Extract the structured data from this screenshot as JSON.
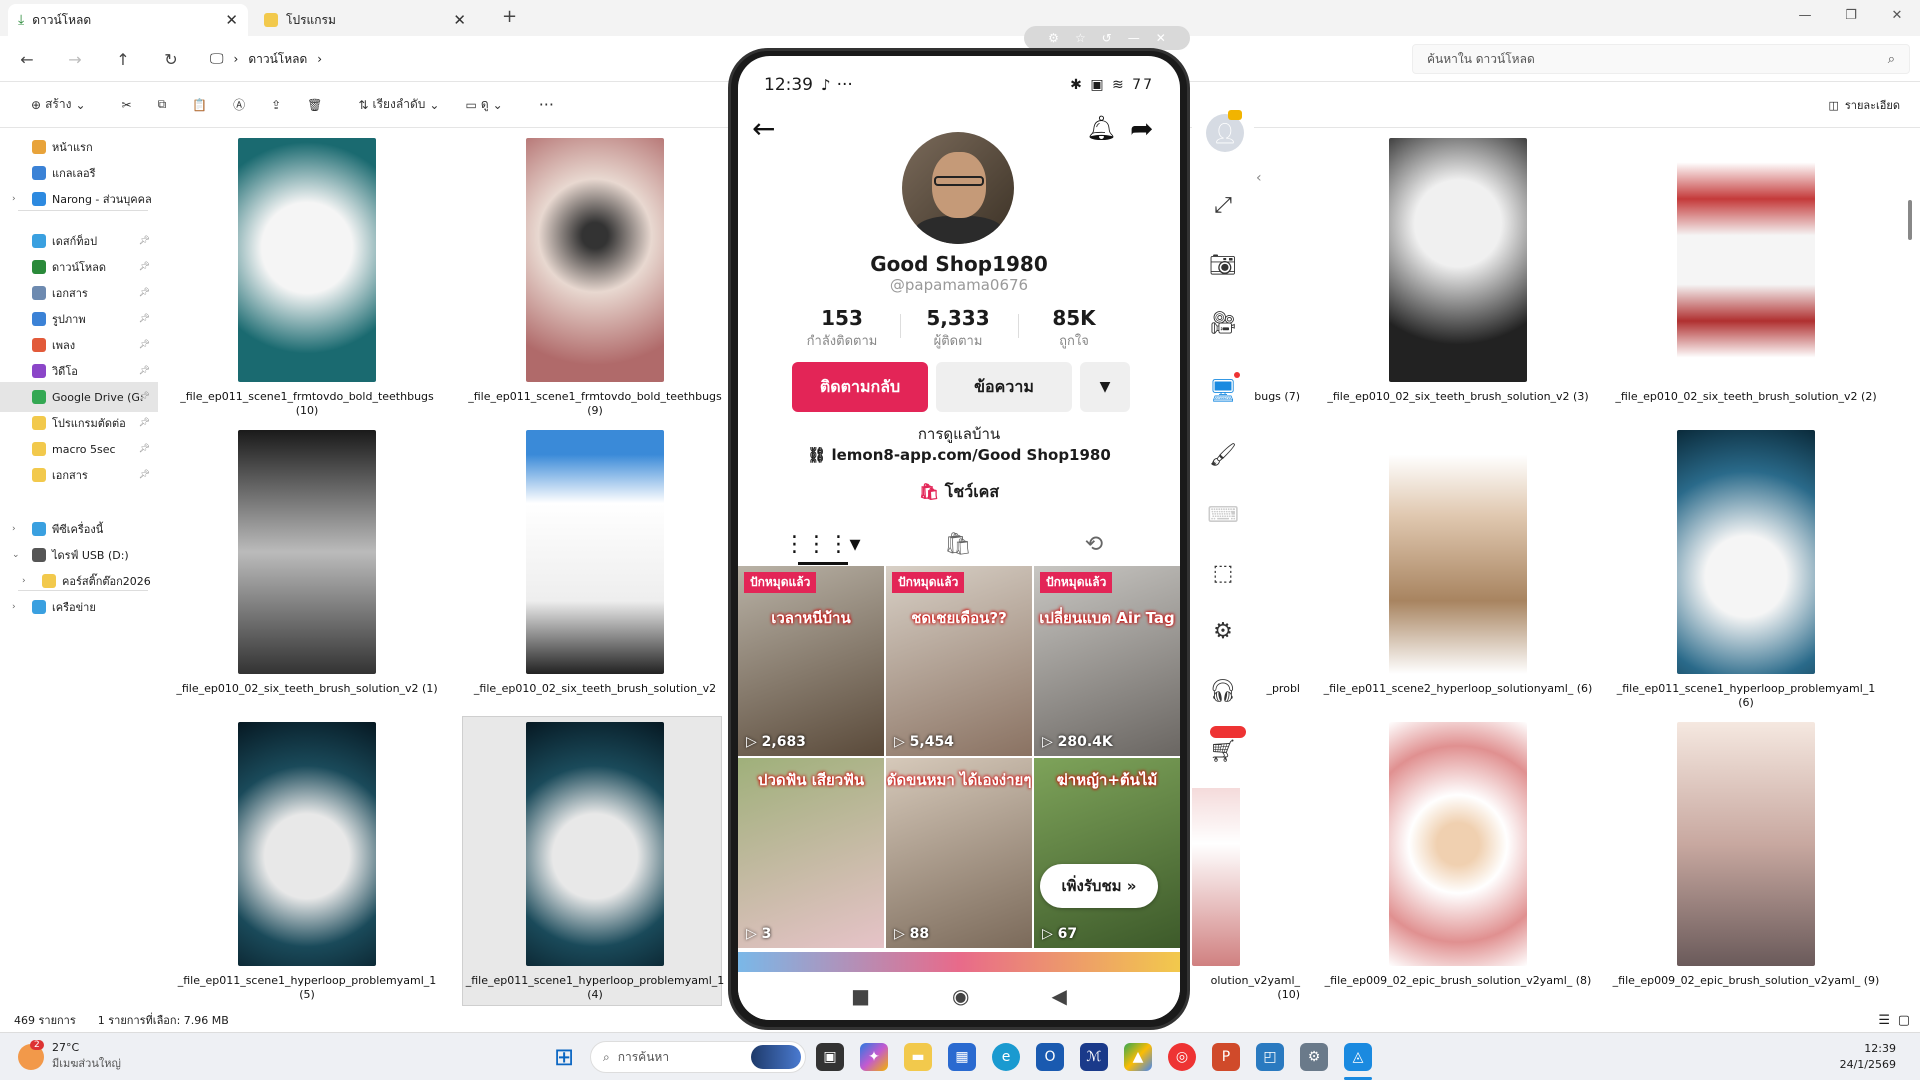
{
  "tabs": [
    {
      "label": "ดาวน์โหลด"
    },
    {
      "label": "โปรแกรม"
    }
  ],
  "address": {
    "crumb": "ดาวน์โหลด",
    "search_placeholder": "ค้นหาใน ดาวน์โหลด"
  },
  "toolbar": {
    "new_label": "สร้าง",
    "sort_label": "เรียงลำดับ",
    "view_label": "ดู",
    "details_label": "รายละเอียด"
  },
  "sidebar": {
    "items": [
      {
        "label": "หน้าแรก",
        "icon": "home-icon",
        "color": "#e8a33a"
      },
      {
        "label": "แกลเลอรี",
        "icon": "gallery-icon",
        "color": "#3b82d6"
      },
      {
        "label": "Narong - ส่วนบุคคล",
        "icon": "cloud-icon",
        "color": "#2d8ae0"
      },
      {
        "label": "เดสก์ท็อป",
        "icon": "desktop-icon",
        "color": "#3aa0e0"
      },
      {
        "label": "ดาวน์โหลด",
        "icon": "download-icon",
        "color": "#2a8a3a"
      },
      {
        "label": "เอกสาร",
        "icon": "document-icon",
        "color": "#6d8ab0"
      },
      {
        "label": "รูปภาพ",
        "icon": "pictures-icon",
        "color": "#3b82d6"
      },
      {
        "label": "เพลง",
        "icon": "music-icon",
        "color": "#e25a3a"
      },
      {
        "label": "วิดีโอ",
        "icon": "video-icon",
        "color": "#8b46c8"
      },
      {
        "label": "Google Drive (G:",
        "icon": "drive-icon",
        "color": "#34a853"
      },
      {
        "label": "โปรแกรมตัดต่อ",
        "icon": "folder-icon",
        "color": "#f2c94c"
      },
      {
        "label": "macro 5sec",
        "icon": "folder-icon",
        "color": "#f2c94c"
      },
      {
        "label": "เอกสาร",
        "icon": "folder-icon",
        "color": "#f2c94c"
      },
      {
        "label": "พีซีเครื่องนี้",
        "icon": "pc-icon",
        "color": "#3aa0e0"
      },
      {
        "label": "ไดรฟ์ USB (D:)",
        "icon": "usb-icon",
        "color": "#555555"
      },
      {
        "label": "คอร์สติ๊กต๊อก2026",
        "icon": "folder-icon",
        "color": "#f2c94c"
      },
      {
        "label": "เครือข่าย",
        "icon": "network-icon",
        "color": "#3aa0e0"
      }
    ]
  },
  "files": [
    {
      "name": "_file_ep011_scene1_frmtovdo_bold_teethbugs (10)"
    },
    {
      "name": "_file_ep011_scene1_frmtovdo_bold_teethbugs (9)"
    },
    {
      "name": "bugs (7)"
    },
    {
      "name": "_file_ep010_02_six_teeth_brush_solution_v2 (3)"
    },
    {
      "name": "_file_ep010_02_six_teeth_brush_solution_v2 (2)"
    },
    {
      "name": "_file_ep010_02_six_teeth_brush_solution_v2 (1)"
    },
    {
      "name": "_file_ep010_02_six_teeth_brush_solution_v2"
    },
    {
      "name": "_probl"
    },
    {
      "name": "_file_ep011_scene2_hyperloop_solutionyaml_ (6)"
    },
    {
      "name": "_file_ep011_scene1_hyperloop_problemyaml_1 (6)"
    },
    {
      "name": "_file_ep011_scene1_hyperloop_problemyaml_1 (5)"
    },
    {
      "name": "_file_ep011_scene1_hyperloop_problemyaml_1 (4)"
    },
    {
      "name": "olution_v2yaml_ (10)"
    },
    {
      "name": "_file_ep009_02_epic_brush_solution_v2yaml_ (8)"
    },
    {
      "name": "_file_ep009_02_epic_brush_solution_v2yaml_ (9)"
    }
  ],
  "status": {
    "count": "469 รายการ",
    "selected": "1 รายการที่เลือก: 7.96 MB"
  },
  "phone": {
    "time": "12:39",
    "status_icons": "✱ ▣ ≋ 77",
    "display_name": "Good Shop1980",
    "username": "@papamama0676",
    "stats": [
      {
        "value": "153",
        "label": "กำลังติดตาม"
      },
      {
        "value": "5,333",
        "label": "ผู้ติดตาม"
      },
      {
        "value": "85K",
        "label": "ถูกใจ"
      }
    ],
    "follow_back_label": "ติดตามกลับ",
    "message_label": "ข้อความ",
    "bio": "การดูแลบ้าน",
    "link": "lemon8-app.com/Good Shop1980",
    "showcase": "โชว์เคส",
    "videos": [
      {
        "views": "2,683",
        "tag": "ปักหมุดแล้ว",
        "overlay": "เวลาหนีบ้าน",
        "colors": [
          "#b9b2a6",
          "#5a4a3a"
        ]
      },
      {
        "views": "5,454",
        "tag": "ปักหมุดแล้ว",
        "overlay": "ชดเชยเดือน??",
        "colors": [
          "#d8d0c6",
          "#8a7262"
        ]
      },
      {
        "views": "280.4K",
        "tag": "ปักหมุดแล้ว",
        "overlay": "เปลี่ยนแบต Air Tag",
        "colors": [
          "#c8c6c2",
          "#6a6662"
        ]
      },
      {
        "views": "3",
        "tag": "",
        "overlay": "ปวดฟัน เสียวฟัน",
        "colors": [
          "#9fb07a",
          "#e6c3c8"
        ]
      },
      {
        "views": "88",
        "tag": "",
        "overlay": "ตัดขนหมา ได้เองง่ายๆ",
        "colors": [
          "#d6c9ba",
          "#7b6a5a"
        ]
      },
      {
        "views": "67",
        "tag": "",
        "overlay": "ฆ่าหญ้า+ต้นไม้",
        "colors": [
          "#7ea35a",
          "#3d5a2a"
        ]
      }
    ],
    "pill_label": "เพิ่งรับชม"
  },
  "taskbar": {
    "temp": "27°C",
    "weather_text": "มีเมฆส่วนใหญ่",
    "search_placeholder": "การค้นหา",
    "time": "12:39",
    "date": "24/1/2569",
    "badge": "2"
  }
}
